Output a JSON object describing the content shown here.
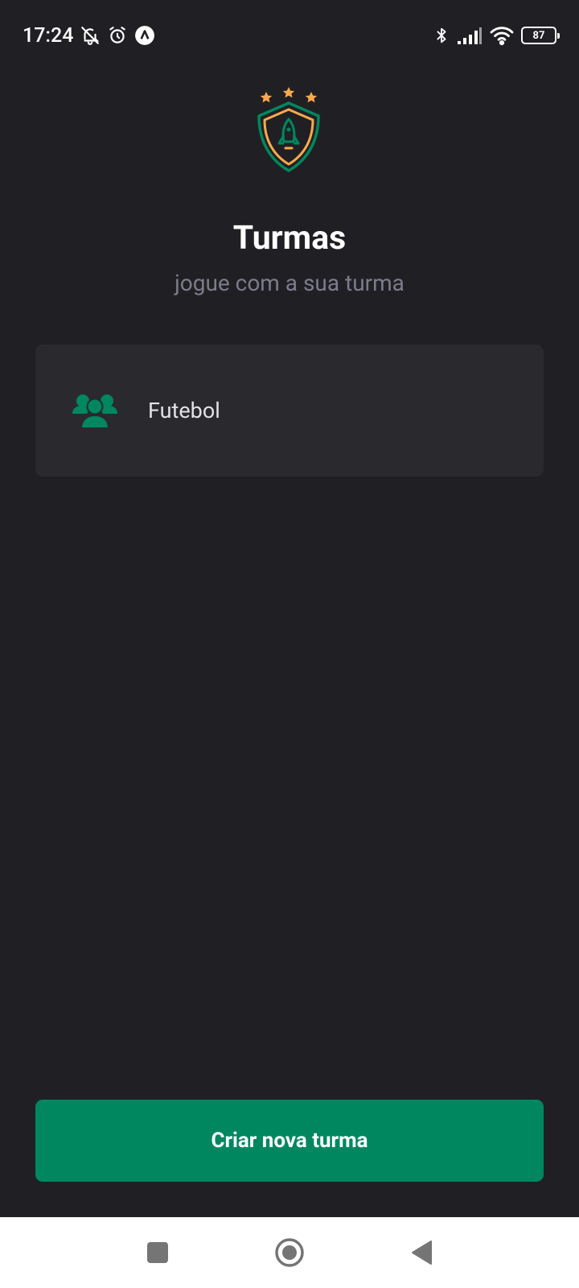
{
  "status_bar": {
    "time": "17:24",
    "battery": "87",
    "icons": [
      "muted-bell-icon",
      "alarm-icon",
      "app-notification-icon",
      "bluetooth-icon",
      "signal-icon",
      "wifi-icon",
      "battery-icon"
    ]
  },
  "header": {
    "logo_icon": "shield-rocket-icon",
    "title": "Turmas",
    "subtitle": "jogue com a sua turma"
  },
  "groups": [
    {
      "name": "Futebol",
      "icon": "users-three-icon"
    }
  ],
  "actions": {
    "create_label": "Criar nova turma"
  },
  "nav": {
    "icons": [
      "recents-icon",
      "home-icon",
      "back-icon"
    ]
  },
  "colors": {
    "background": "#202024",
    "card": "#29292e",
    "accent_green": "#00875f",
    "star_orange": "#fba94c",
    "subtitle_gray": "#7c7c8a"
  }
}
